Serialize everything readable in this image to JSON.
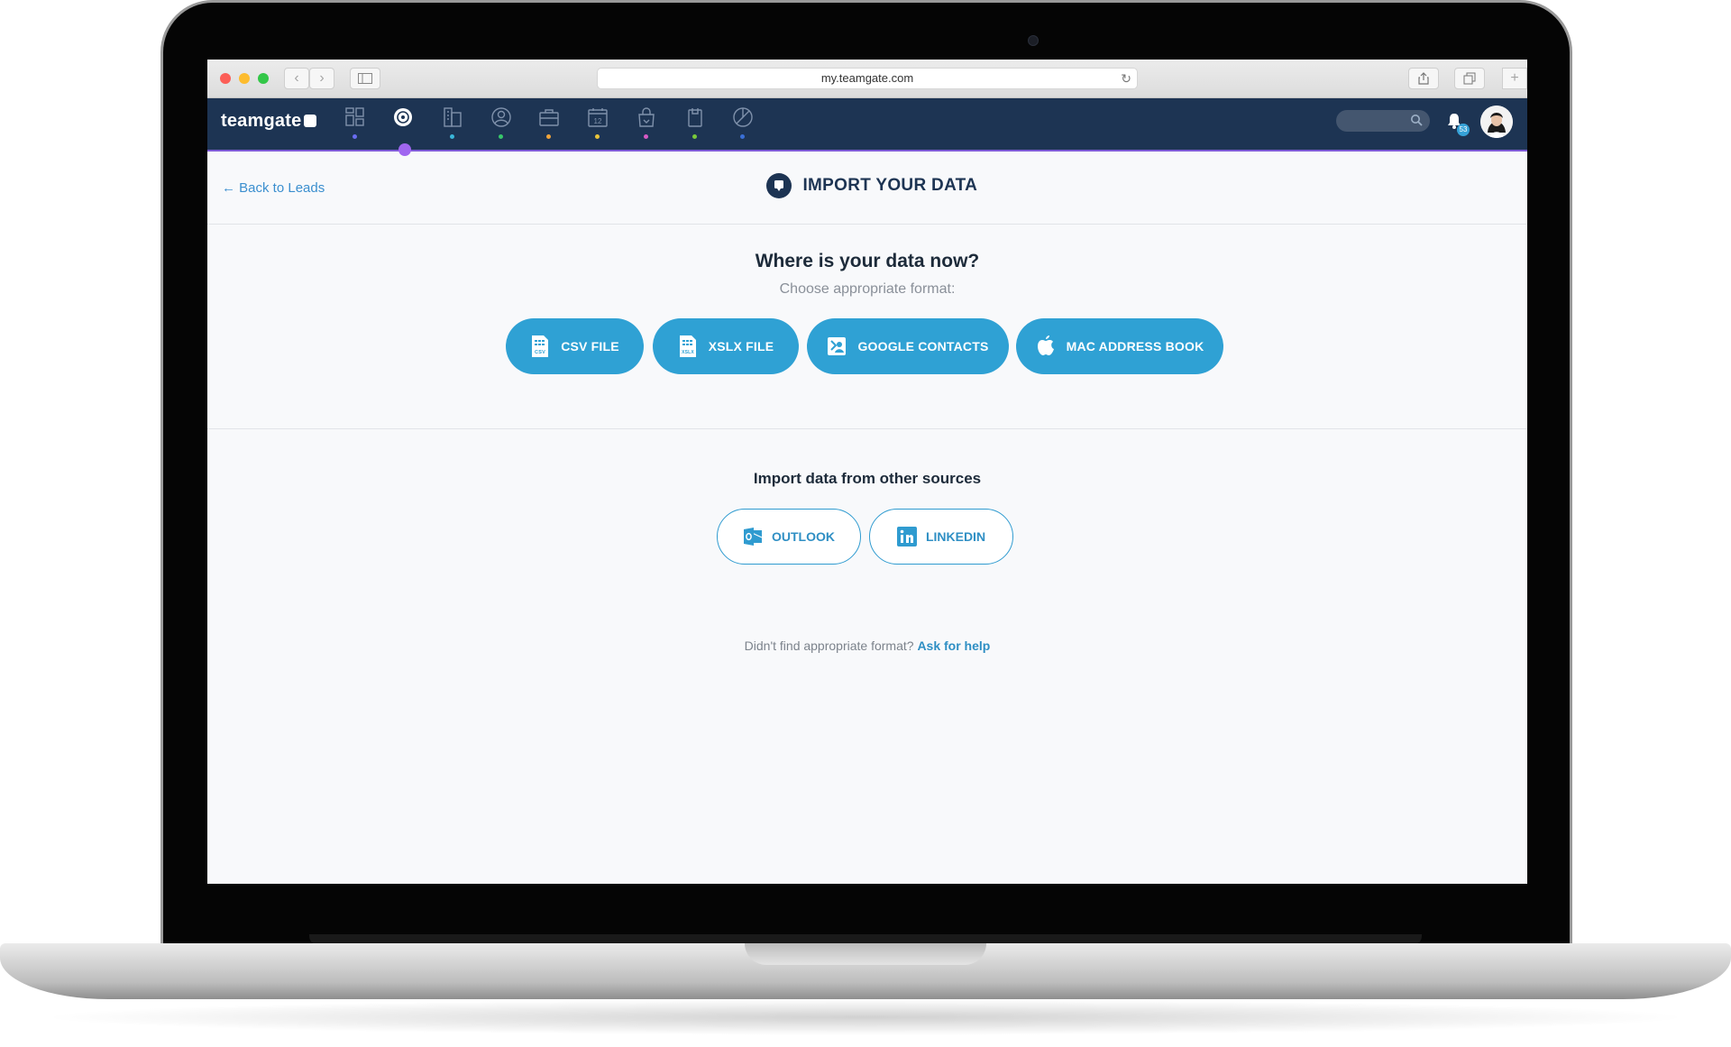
{
  "browser": {
    "url": "my.teamgate.com"
  },
  "app": {
    "logo_text": "teamgate",
    "nav_icons": [
      {
        "icon": "dashboard-icon",
        "dot": "#6a6cf0"
      },
      {
        "icon": "leads-icon",
        "dot": ""
      },
      {
        "icon": "companies-icon",
        "dot": "#3ab6d9"
      },
      {
        "icon": "contacts-icon",
        "dot": "#37c66a"
      },
      {
        "icon": "deals-icon",
        "dot": "#f0a43a"
      },
      {
        "icon": "calendar-icon",
        "dot": "#e8c43a"
      },
      {
        "icon": "sales-icon",
        "dot": "#d65ac4"
      },
      {
        "icon": "notes-icon",
        "dot": "#79c93a"
      },
      {
        "icon": "reports-icon",
        "dot": "#3a6fd6"
      }
    ],
    "calendar_day": "12",
    "notification_count": "53"
  },
  "page": {
    "back_label": "Back to Leads",
    "title": "IMPORT YOUR DATA",
    "question": "Where is your data now?",
    "choose_label": "Choose appropriate format:",
    "formats": [
      {
        "label": "CSV FILE",
        "icon": "csv-file-icon",
        "icon_text": "CSV"
      },
      {
        "label": "XSLX FILE",
        "icon": "xlsx-file-icon",
        "icon_text": "XSLX"
      },
      {
        "label": "GOOGLE CONTACTS",
        "icon": "google-contacts-icon"
      },
      {
        "label": "MAC ADDRESS BOOK",
        "icon": "apple-icon"
      }
    ],
    "other_sources_title": "Import data from other sources",
    "other_sources": [
      {
        "label": "OUTLOOK",
        "icon": "outlook-icon"
      },
      {
        "label": "LINKEDIN",
        "icon": "linkedin-icon"
      }
    ],
    "help_text": "Didn't find appropriate format?",
    "help_link": "Ask for help"
  },
  "colors": {
    "nav_bg": "#1d3453",
    "accent": "#2fa1d4",
    "active_indicator": "#a066f0"
  }
}
